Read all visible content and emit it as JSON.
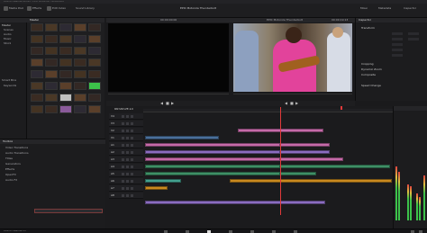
{
  "app": {
    "window_title": "DaVinci Resolve Studio - EPIC Motorola Thunderbolt",
    "project_title": "EPIC Motorola Thunderbolt",
    "version_label": "DaVinci Resolve 15"
  },
  "toolbar": {
    "media_pool_label": "Media Pool",
    "effects_label": "Effects",
    "edit_index_label": "Edit Index",
    "sound_label": "Sound Library",
    "inspector_label": "Inspector",
    "mixer_label": "Mixer",
    "metadata_label": "Metadata"
  },
  "media_pool": {
    "header": "Master",
    "bins": [
      "Master",
      "Scenes",
      "Audio",
      "Music",
      "Stock"
    ],
    "smart_bins_label": "Smart Bins",
    "keywords_label": "Keywords"
  },
  "effects": {
    "header": "Toolbox",
    "items": [
      "Video Transitions",
      "Audio Transitions",
      "Titles",
      "Generators",
      "Effects",
      "OpenFX",
      "Audio FX"
    ]
  },
  "viewer": {
    "timecode_source": "00:00:00:00",
    "timecode_timeline": "00:00:19:13",
    "timeline_name": "EPIC Motorola Thunderbolt"
  },
  "inspector": {
    "header": "Inspector",
    "sections": [
      "Transform",
      "Cropping",
      "Dynamic Zoom",
      "Composite",
      "Speed Change"
    ]
  },
  "timeline": {
    "timecode": "00:00:19:13",
    "tracks": [
      "V4",
      "V3",
      "V2",
      "V1",
      "A1",
      "A2",
      "A3",
      "A4",
      "A5",
      "A6",
      "A7",
      "A8"
    ]
  },
  "colors": {
    "accent_red": "#e23a3a",
    "clip_blue": "#4a6f9a",
    "clip_pink": "#c56aa8",
    "clip_green": "#3f8f66",
    "clip_teal": "#43a08e",
    "clip_orange": "#c9891f",
    "clip_purple": "#8a6cbf"
  }
}
